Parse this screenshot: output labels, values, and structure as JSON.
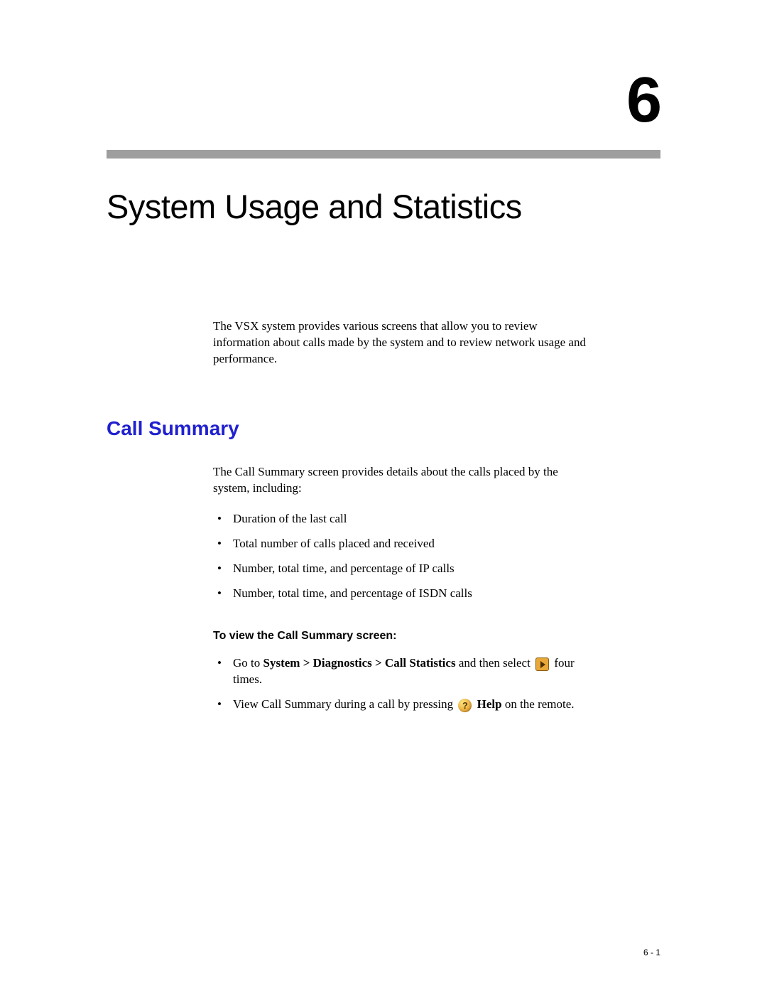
{
  "chapter": {
    "number": "6",
    "title": "System Usage and Statistics"
  },
  "intro": "The VSX system provides various screens that allow you to review information about calls made by the system and to review network usage and performance.",
  "section": {
    "heading": "Call Summary",
    "para": "The Call Summary screen provides details about the calls placed by the system, including:",
    "bullets": [
      "Duration of the last call",
      "Total number of calls placed and received",
      "Number, total time, and percentage of IP calls",
      "Number, total time, and percentage of ISDN calls"
    ],
    "subheading": "To view the Call Summary screen:",
    "steps": {
      "step1_pre": "Go to ",
      "step1_bold": "System > Diagnostics > Call Statistics",
      "step1_mid": " and then select ",
      "step1_post": " four times.",
      "step2_pre": "View Call Summary during a call by pressing ",
      "step2_bold": "Help",
      "step2_post": " on the remote."
    }
  },
  "page_number": "6 - 1"
}
